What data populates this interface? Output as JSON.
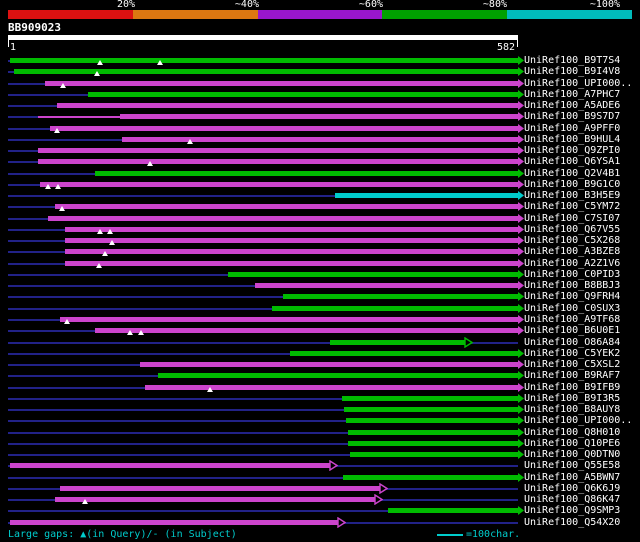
{
  "chart_data": {
    "type": "bar",
    "subtype": "sequence-alignment-overview",
    "title": "BB909023",
    "x_range": [
      1,
      582
    ],
    "x_start_label": "1",
    "x_end_label": "582",
    "identity_scale": {
      "labels": [
        "20%",
        "~40%",
        "~60%",
        "~80%",
        "~100%"
      ],
      "colors": [
        "#dd1111",
        "#dd7711",
        "#9916cc",
        "#00a000",
        "#00bbbb"
      ]
    },
    "bar_colors": {
      "green": "#00bb00",
      "magenta": "#cc44cc",
      "cyan": "#00cccc"
    },
    "track_color": "#222288",
    "rows": [
      {
        "label": "UniRef100_B9T7S4",
        "color": "green",
        "segments": [
          {
            "s": 2,
            "e": 582
          }
        ],
        "gaps": [
          105,
          173
        ],
        "arrow": "filled"
      },
      {
        "label": "UniRef100_B9I4V8",
        "color": "green",
        "segments": [
          {
            "s": 7,
            "e": 582
          }
        ],
        "gaps": [
          102
        ],
        "arrow": "filled"
      },
      {
        "label": "UniRef100_UPI000..",
        "color": "magenta",
        "segments": [
          {
            "s": 42,
            "e": 582
          }
        ],
        "gaps": [
          63
        ],
        "arrow": "filled"
      },
      {
        "label": "UniRef100_A7PHC7",
        "color": "green",
        "segments": [
          {
            "s": 91,
            "e": 582
          }
        ],
        "gaps": [],
        "arrow": "filled"
      },
      {
        "label": "UniRef100_A5ADE6",
        "color": "magenta",
        "segments": [
          {
            "s": 56,
            "e": 582
          }
        ],
        "gaps": [],
        "arrow": "filled"
      },
      {
        "label": "UniRef100_B9S7D7",
        "color": "magenta",
        "segments": [
          {
            "s": 34,
            "e": 128,
            "thin": true
          },
          {
            "s": 128,
            "e": 582
          }
        ],
        "gaps": [],
        "arrow": "filled"
      },
      {
        "label": "UniRef100_A9PFF0",
        "color": "magenta",
        "segments": [
          {
            "s": 48,
            "e": 582
          }
        ],
        "gaps": [
          56
        ],
        "arrow": "filled"
      },
      {
        "label": "UniRef100_B9HUL4",
        "color": "magenta",
        "segments": [
          {
            "s": 130,
            "e": 582
          }
        ],
        "gaps": [
          208
        ],
        "arrow": "filled"
      },
      {
        "label": "UniRef100_Q9ZPI0",
        "color": "magenta",
        "segments": [
          {
            "s": 34,
            "e": 582
          }
        ],
        "gaps": [],
        "arrow": "filled"
      },
      {
        "label": "UniRef100_Q6YSA1",
        "color": "magenta",
        "segments": [
          {
            "s": 34,
            "e": 582
          }
        ],
        "gaps": [
          162
        ],
        "arrow": "filled"
      },
      {
        "label": "UniRef100_Q2V4B1",
        "color": "green",
        "segments": [
          {
            "s": 99,
            "e": 582
          }
        ],
        "gaps": [],
        "arrow": "filled"
      },
      {
        "label": "UniRef100_B9G1C0",
        "color": "magenta",
        "segments": [
          {
            "s": 37,
            "e": 582
          }
        ],
        "gaps": [
          46,
          57
        ],
        "arrow": "filled"
      },
      {
        "label": "UniRef100_B3H5E9",
        "color": "cyan",
        "segments": [
          {
            "s": 373,
            "e": 582
          }
        ],
        "gaps": [],
        "arrow": "filled"
      },
      {
        "label": "UniRef100_C5YM72",
        "color": "magenta",
        "segments": [
          {
            "s": 54,
            "e": 582
          }
        ],
        "gaps": [
          62
        ],
        "arrow": "filled"
      },
      {
        "label": "UniRef100_C7SI07",
        "color": "magenta",
        "segments": [
          {
            "s": 46,
            "e": 582
          }
        ],
        "gaps": [],
        "arrow": "filled"
      },
      {
        "label": "UniRef100_Q67V55",
        "color": "magenta",
        "segments": [
          {
            "s": 65,
            "e": 582
          }
        ],
        "gaps": [
          105,
          116
        ],
        "arrow": "filled"
      },
      {
        "label": "UniRef100_C5X268",
        "color": "magenta",
        "segments": [
          {
            "s": 65,
            "e": 582
          }
        ],
        "gaps": [
          119
        ],
        "arrow": "filled"
      },
      {
        "label": "UniRef100_A3BZE8",
        "color": "magenta",
        "segments": [
          {
            "s": 65,
            "e": 582
          }
        ],
        "gaps": [
          111
        ],
        "arrow": "filled"
      },
      {
        "label": "UniRef100_A2Z1V6",
        "color": "magenta",
        "segments": [
          {
            "s": 65,
            "e": 582
          }
        ],
        "gaps": [
          104
        ],
        "arrow": "filled"
      },
      {
        "label": "UniRef100_C0PID3",
        "color": "green",
        "segments": [
          {
            "s": 251,
            "e": 582
          }
        ],
        "gaps": [],
        "arrow": "filled"
      },
      {
        "label": "UniRef100_B8BBJ3",
        "color": "magenta",
        "segments": [
          {
            "s": 282,
            "e": 582
          }
        ],
        "gaps": [],
        "arrow": "filled"
      },
      {
        "label": "UniRef100_Q9FRH4",
        "color": "green",
        "segments": [
          {
            "s": 314,
            "e": 582
          }
        ],
        "gaps": [],
        "arrow": "filled"
      },
      {
        "label": "UniRef100_C0SUX3",
        "color": "green",
        "segments": [
          {
            "s": 301,
            "e": 582
          }
        ],
        "gaps": [],
        "arrow": "filled"
      },
      {
        "label": "UniRef100_A9TF68",
        "color": "magenta",
        "segments": [
          {
            "s": 59,
            "e": 582
          }
        ],
        "gaps": [
          67
        ],
        "arrow": "filled"
      },
      {
        "label": "UniRef100_B6U0E1",
        "color": "magenta",
        "segments": [
          {
            "s": 99,
            "e": 582
          }
        ],
        "gaps": [
          139,
          152
        ],
        "arrow": "filled"
      },
      {
        "label": "UniRef100_O86A84",
        "color": "green",
        "segments": [
          {
            "s": 367,
            "e": 521
          }
        ],
        "gaps": [],
        "arrow": "open"
      },
      {
        "label": "UniRef100_C5YEK2",
        "color": "green",
        "segments": [
          {
            "s": 322,
            "e": 582
          }
        ],
        "gaps": [],
        "arrow": "filled"
      },
      {
        "label": "UniRef100_C5XSL2",
        "color": "magenta",
        "segments": [
          {
            "s": 151,
            "e": 582
          }
        ],
        "gaps": [],
        "arrow": "filled"
      },
      {
        "label": "UniRef100_B9RAF7",
        "color": "green",
        "segments": [
          {
            "s": 171,
            "e": 582
          }
        ],
        "gaps": [],
        "arrow": "filled"
      },
      {
        "label": "UniRef100_B9IFB9",
        "color": "magenta",
        "segments": [
          {
            "s": 156,
            "e": 582
          }
        ],
        "gaps": [
          230
        ],
        "arrow": "filled"
      },
      {
        "label": "UniRef100_B9I3R5",
        "color": "green",
        "segments": [
          {
            "s": 381,
            "e": 582
          }
        ],
        "gaps": [],
        "arrow": "filled"
      },
      {
        "label": "UniRef100_B8AUY8",
        "color": "green",
        "segments": [
          {
            "s": 383,
            "e": 582
          }
        ],
        "gaps": [],
        "arrow": "filled"
      },
      {
        "label": "UniRef100_UPI000..",
        "color": "green",
        "segments": [
          {
            "s": 386,
            "e": 582
          }
        ],
        "gaps": [],
        "arrow": "filled"
      },
      {
        "label": "UniRef100_Q8H010",
        "color": "green",
        "segments": [
          {
            "s": 388,
            "e": 582
          }
        ],
        "gaps": [],
        "arrow": "filled"
      },
      {
        "label": "UniRef100_Q10PE6",
        "color": "green",
        "segments": [
          {
            "s": 388,
            "e": 582
          }
        ],
        "gaps": [],
        "arrow": "filled"
      },
      {
        "label": "UniRef100_Q0DTN0",
        "color": "green",
        "segments": [
          {
            "s": 390,
            "e": 582
          }
        ],
        "gaps": [],
        "arrow": "filled"
      },
      {
        "label": "UniRef100_Q55E58",
        "color": "magenta",
        "segments": [
          {
            "s": 2,
            "e": 367
          }
        ],
        "gaps": [],
        "arrow": "open"
      },
      {
        "label": "UniRef100_A5BWN7",
        "color": "green",
        "segments": [
          {
            "s": 382,
            "e": 582
          }
        ],
        "gaps": [],
        "arrow": "filled"
      },
      {
        "label": "UniRef100_Q6K6J9",
        "color": "magenta",
        "segments": [
          {
            "s": 59,
            "e": 424
          }
        ],
        "gaps": [],
        "arrow": "open"
      },
      {
        "label": "UniRef100_Q86K47",
        "color": "magenta",
        "segments": [
          {
            "s": 54,
            "e": 419
          }
        ],
        "gaps": [
          88
        ],
        "arrow": "open"
      },
      {
        "label": "UniRef100_Q9SMP3",
        "color": "green",
        "segments": [
          {
            "s": 434,
            "e": 582
          }
        ],
        "gaps": [],
        "arrow": "filled"
      },
      {
        "label": "UniRef100_Q54X20",
        "color": "magenta",
        "segments": [
          {
            "s": 2,
            "e": 377
          }
        ],
        "gaps": [],
        "arrow": "open"
      }
    ],
    "footer": {
      "gaps_note": "Large gaps: ▲(in Query)/- (in Subject)",
      "scale_legend": "=100char."
    }
  }
}
